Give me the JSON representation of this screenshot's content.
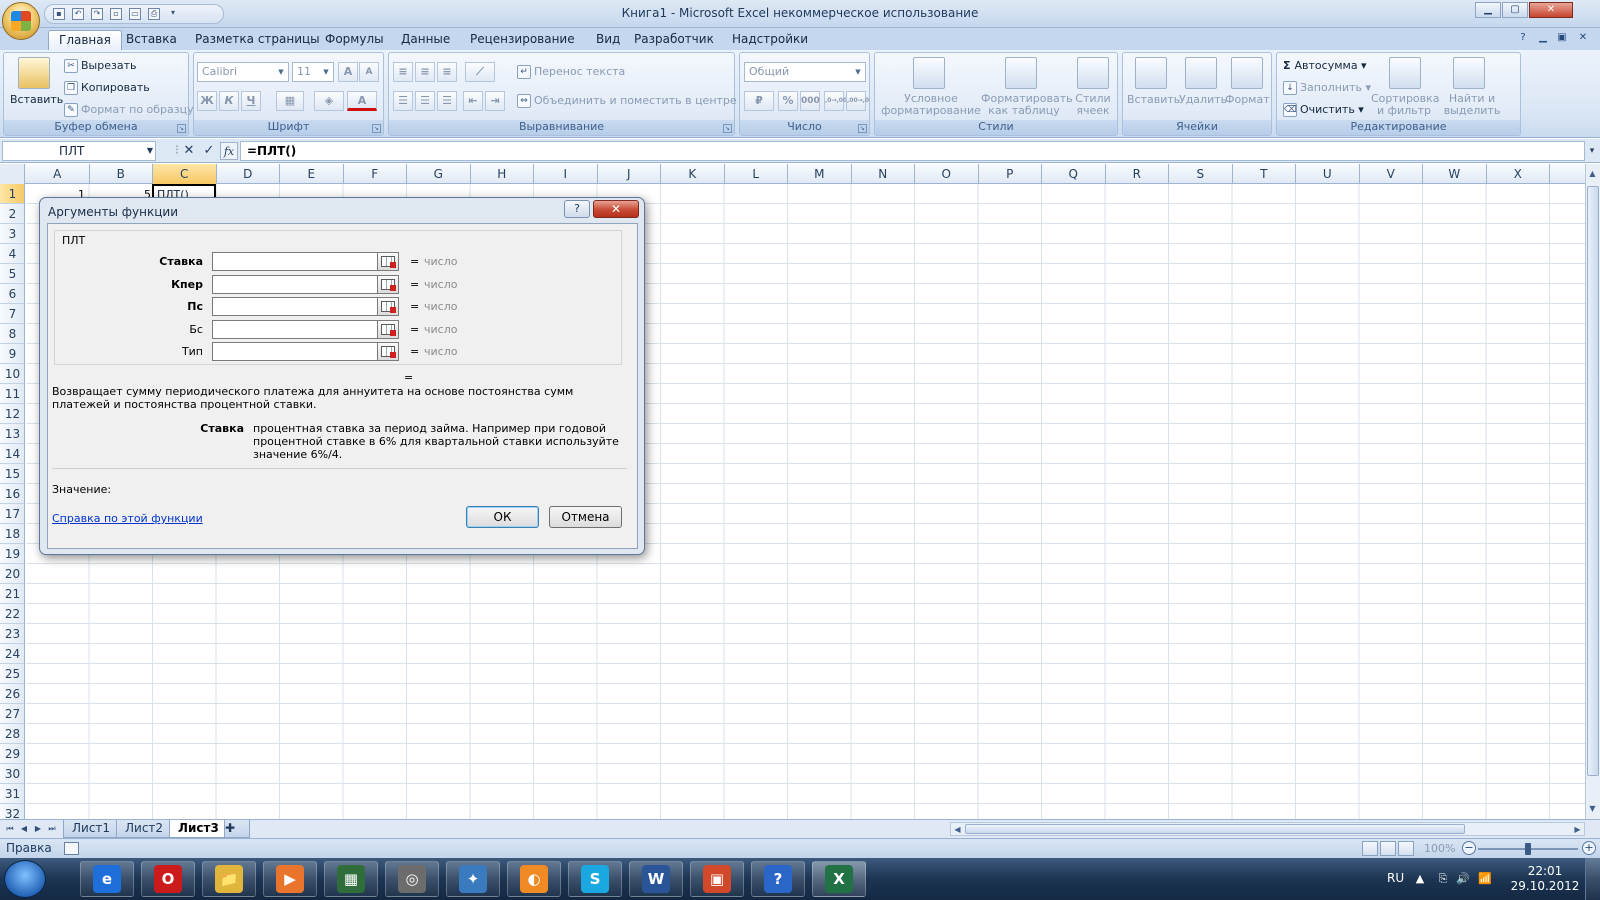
{
  "window": {
    "title": "Книга1 - Microsoft Excel некоммерческое использование",
    "controls": {
      "minimize": "▁",
      "maximize": "▢",
      "close": "✕"
    },
    "doc_controls": {
      "minimize": "▁",
      "restore": "▣",
      "close": "✕"
    }
  },
  "tabs": [
    "Главная",
    "Вставка",
    "Разметка страницы",
    "Формулы",
    "Данные",
    "Рецензирование",
    "Вид",
    "Разработчик",
    "Надстройки"
  ],
  "active_tab": "Главная",
  "ribbon": {
    "clipboard": {
      "label": "Буфер обмена",
      "paste": "Вставить",
      "cut": "Вырезать",
      "copy": "Копировать",
      "format_painter": "Формат по образцу"
    },
    "font": {
      "label": "Шрифт",
      "font_name": "Calibri",
      "font_size": "11",
      "bold": "Ж",
      "italic": "К",
      "underline": "Ч",
      "grow": "A",
      "shrink": "A"
    },
    "alignment": {
      "label": "Выравнивание",
      "wrap": "Перенос текста",
      "merge": "Объединить и поместить в центре"
    },
    "number": {
      "label": "Число",
      "format": "Общий",
      "percent": "%",
      "thousands": "000",
      "inc_decimal": ",0→,00",
      "dec_decimal": ",00→,0"
    },
    "styles": {
      "label": "Стили",
      "conditional": "Условное форматирование",
      "as_table": "Форматировать как таблицу",
      "cell_styles": "Стили ячеек"
    },
    "cells": {
      "label": "Ячейки",
      "insert": "Вставить",
      "delete": "Удалить",
      "format": "Формат"
    },
    "editing": {
      "label": "Редактирование",
      "autosum": "Автосумма",
      "fill": "Заполнить",
      "clear": "Очистить",
      "sort": "Сортировка и фильтр",
      "find": "Найти и выделить"
    }
  },
  "formula_bar": {
    "name_box": "ПЛТ",
    "formula": "=ПЛТ()",
    "fx": "fx",
    "cancel": "✕",
    "enter": "✓"
  },
  "columns": [
    "A",
    "B",
    "C",
    "D",
    "E",
    "F",
    "G",
    "H",
    "I",
    "J",
    "K",
    "L",
    "M",
    "N",
    "O",
    "P",
    "Q",
    "R",
    "S",
    "T",
    "U",
    "V",
    "W",
    "X"
  ],
  "rows": [
    "1",
    "2",
    "3",
    "4",
    "5",
    "6",
    "7",
    "8",
    "9",
    "10",
    "11",
    "12",
    "13",
    "14",
    "15",
    "16",
    "17",
    "18",
    "19",
    "20",
    "21",
    "22",
    "23",
    "24",
    "25",
    "26",
    "27",
    "28",
    "29",
    "30",
    "31",
    "32"
  ],
  "cells": {
    "A1": "1",
    "B1": "5",
    "C1": "ПЛТ()"
  },
  "sheets": [
    "Лист1",
    "Лист2",
    "Лист3"
  ],
  "active_sheet": "Лист3",
  "status": {
    "mode": "Правка",
    "zoom": "100%",
    "zoom_minus": "−",
    "zoom_plus": "+"
  },
  "dialog": {
    "title": "Аргументы функции",
    "help_btn": "?",
    "close_btn": "✕",
    "function_name": "ПЛТ",
    "args": [
      {
        "label": "Ставка",
        "bold": true,
        "value": "",
        "result": "число"
      },
      {
        "label": "Кпер",
        "bold": true,
        "value": "",
        "result": "число"
      },
      {
        "label": "Пс",
        "bold": true,
        "value": "",
        "result": "число"
      },
      {
        "label": "Бс",
        "bold": false,
        "value": "",
        "result": "число"
      },
      {
        "label": "Тип",
        "bold": false,
        "value": "",
        "result": "число"
      }
    ],
    "eq": "=",
    "description": "Возвращает сумму периодического платежа для аннуитета на основе постоянства сумм платежей и постоянства процентной ставки.",
    "arg_desc_name": "Ставка",
    "arg_desc_text": "процентная ставка за период займа. Например при годовой процентной ставке в 6% для квартальной ставки используйте значение 6%/4.",
    "value_label": "Значение:",
    "help_link": "Справка по этой функции",
    "ok": "ОК",
    "cancel": "Отмена"
  },
  "taskbar": {
    "apps": [
      "e",
      "O",
      "📁",
      "▶",
      "▦",
      "◎",
      "✦",
      "◐",
      "S",
      "W",
      "▣",
      "?",
      "X"
    ],
    "language": "RU",
    "time": "22:01",
    "date": "29.10.2012"
  }
}
